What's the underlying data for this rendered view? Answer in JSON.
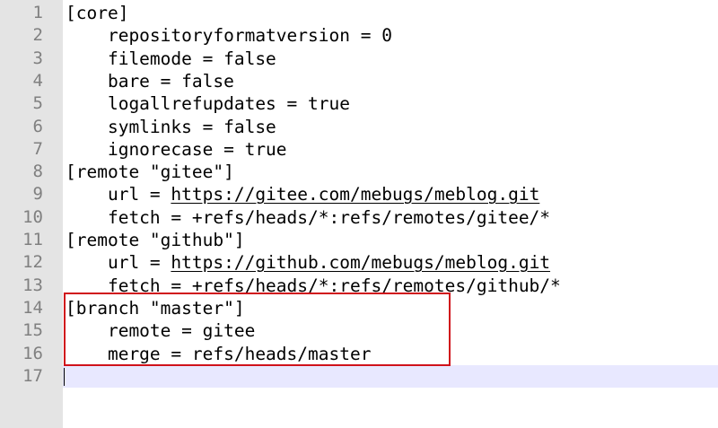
{
  "editor": {
    "lines": [
      {
        "num": "1",
        "pre": "[core]",
        "link": "",
        "post": ""
      },
      {
        "num": "2",
        "pre": "    repositoryformatversion = 0",
        "link": "",
        "post": ""
      },
      {
        "num": "3",
        "pre": "    filemode = false",
        "link": "",
        "post": ""
      },
      {
        "num": "4",
        "pre": "    bare = false",
        "link": "",
        "post": ""
      },
      {
        "num": "5",
        "pre": "    logallrefupdates = true",
        "link": "",
        "post": ""
      },
      {
        "num": "6",
        "pre": "    symlinks = false",
        "link": "",
        "post": ""
      },
      {
        "num": "7",
        "pre": "    ignorecase = true",
        "link": "",
        "post": ""
      },
      {
        "num": "8",
        "pre": "[remote \"gitee\"]",
        "link": "",
        "post": ""
      },
      {
        "num": "9",
        "pre": "    url = ",
        "link": "https://gitee.com/mebugs/meblog.git",
        "post": ""
      },
      {
        "num": "10",
        "pre": "    fetch = +refs/heads/*:refs/remotes/gitee/*",
        "link": "",
        "post": ""
      },
      {
        "num": "11",
        "pre": "[remote \"github\"]",
        "link": "",
        "post": ""
      },
      {
        "num": "12",
        "pre": "    url = ",
        "link": "https://github.com/mebugs/meblog.git",
        "post": ""
      },
      {
        "num": "13",
        "pre": "    fetch = +refs/heads/*:refs/remotes/github/*",
        "link": "",
        "post": ""
      },
      {
        "num": "14",
        "pre": "[branch \"master\"]",
        "link": "",
        "post": ""
      },
      {
        "num": "15",
        "pre": "    remote = gitee",
        "link": "",
        "post": ""
      },
      {
        "num": "16",
        "pre": "    merge = refs/heads/master",
        "link": "",
        "post": ""
      },
      {
        "num": "17",
        "pre": "",
        "link": "",
        "post": ""
      }
    ],
    "current_line": "17"
  },
  "colors": {
    "gutter_bg": "#e4e4e4",
    "line_number": "#808080",
    "current_line_bg": "#e8e8ff",
    "highlight_box": "#d0121b",
    "text": "#000000"
  }
}
